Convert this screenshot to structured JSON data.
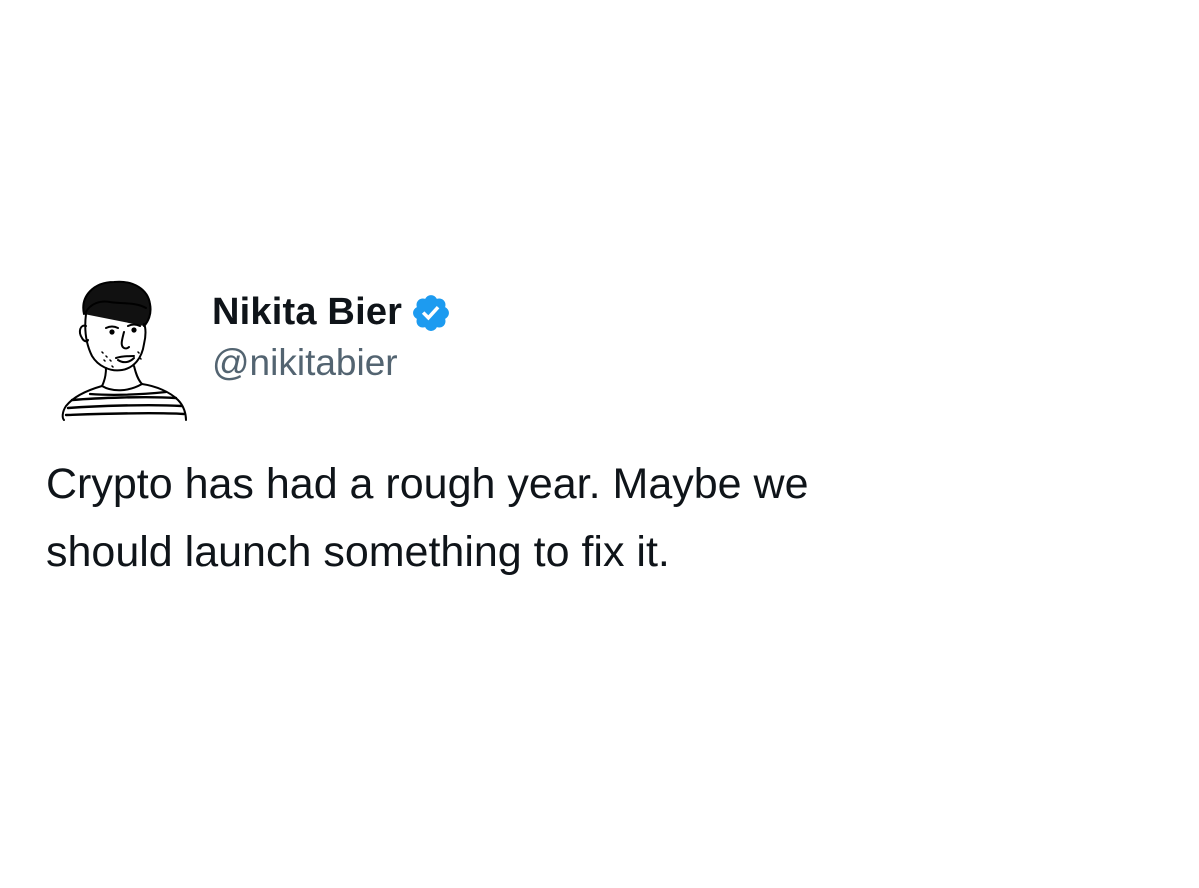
{
  "tweet": {
    "author": {
      "display_name": "Nikita Bier",
      "handle": "@nikitabier",
      "verified": true,
      "avatar_icon": "sketched-portrait-avatar"
    },
    "text": "Crypto has had a rough year. Maybe we\nshould launch something to fix it."
  },
  "colors": {
    "text_primary": "#0f1419",
    "text_secondary": "#536471",
    "verified_blue": "#1d9bf0",
    "background": "#ffffff"
  }
}
